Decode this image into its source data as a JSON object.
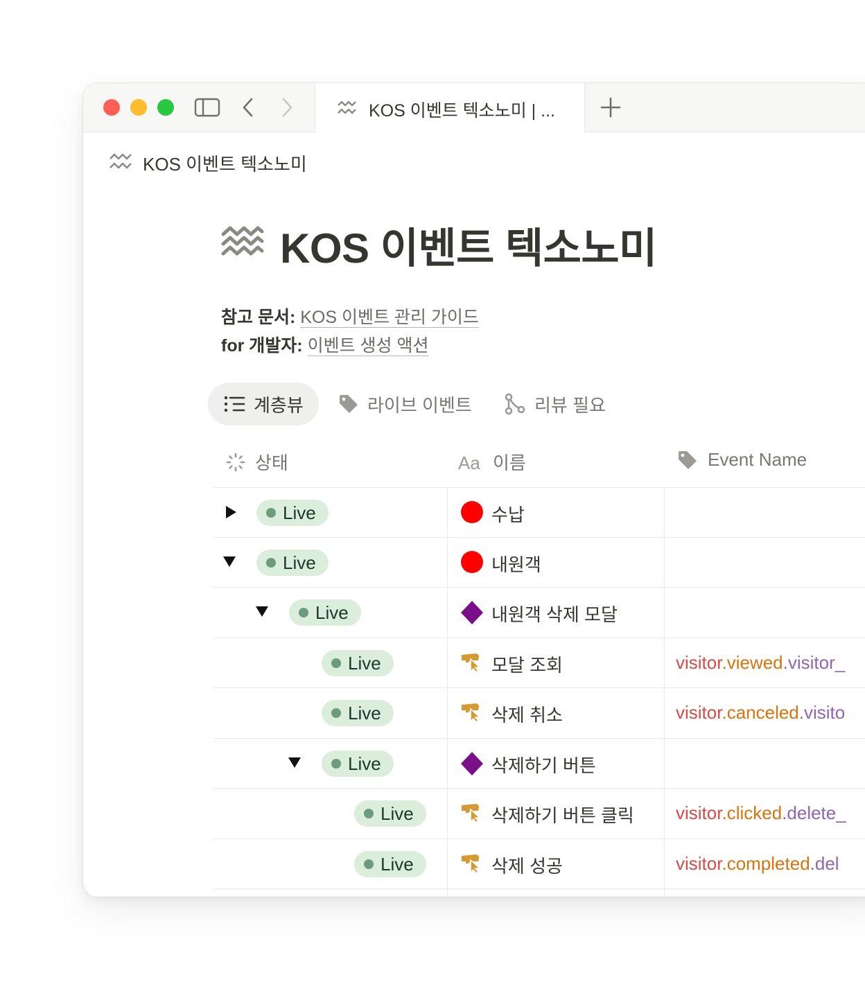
{
  "browser": {
    "tab_title": "KOS 이벤트 텍소노미 | ...",
    "new_tab_symbol": "+"
  },
  "breadcrumb": {
    "title": "KOS 이벤트 텍소노미"
  },
  "page": {
    "title": "KOS 이벤트 텍소노미",
    "refs": [
      {
        "label": "참고 문서:",
        "link": "KOS 이벤트 관리 가이드"
      },
      {
        "label": "for 개발자:",
        "link": "이벤트 생성 액션"
      }
    ]
  },
  "views": [
    {
      "label": "계층뷰",
      "icon": "list-tree-icon",
      "active": true
    },
    {
      "label": "라이브 이벤트",
      "icon": "tag-icon",
      "active": false
    },
    {
      "label": "리뷰 필요",
      "icon": "branch-icon",
      "active": false
    }
  ],
  "table": {
    "columns": [
      {
        "label": "상태",
        "icon": "status-loader-icon"
      },
      {
        "label": "이름",
        "icon": "text-type-icon"
      },
      {
        "label": "Event Name",
        "icon": "tag-icon"
      }
    ],
    "rows": [
      {
        "toggle": "collapsed",
        "level": 0,
        "status": "Live",
        "icon": "red-circle-icon",
        "name": "수납",
        "event": []
      },
      {
        "toggle": "expanded",
        "level": 0,
        "status": "Live",
        "icon": "red-circle-icon",
        "name": "내원객",
        "event": []
      },
      {
        "toggle": "expanded",
        "level": 1,
        "status": "Live",
        "icon": "purple-diamond-icon",
        "name": "내원객 삭제 모달",
        "event": []
      },
      {
        "toggle": "none",
        "level": 2,
        "status": "Live",
        "icon": "pointer-click-icon",
        "name": "모달 조회",
        "event": [
          "visitor",
          ".viewed",
          ".visitor_"
        ]
      },
      {
        "toggle": "none",
        "level": 2,
        "status": "Live",
        "icon": "pointer-click-icon",
        "name": "삭제 취소",
        "event": [
          "visitor",
          ".canceled",
          ".visito"
        ]
      },
      {
        "toggle": "expanded",
        "level": 2,
        "status": "Live",
        "icon": "purple-diamond-icon",
        "name": "삭제하기 버튼",
        "event": []
      },
      {
        "toggle": "none",
        "level": 3,
        "status": "Live",
        "icon": "pointer-click-icon",
        "name": "삭제하기 버튼 클릭",
        "event": [
          "visitor",
          ".clicked",
          ".delete_"
        ]
      },
      {
        "toggle": "none",
        "level": 3,
        "status": "Live",
        "icon": "pointer-click-icon",
        "name": "삭제 성공",
        "event": [
          "visitor",
          ".completed",
          ".del"
        ]
      }
    ]
  },
  "colors": {
    "live_pill_bg": "#dbeddb",
    "live_dot": "#6c9b7d",
    "event_object": "#d44c47",
    "event_action": "#d9730d",
    "event_target": "#9065b0",
    "red_circle": "#ff0000",
    "purple_diamond": "#7b0f8a",
    "pointer_icon": "#d69a34"
  }
}
